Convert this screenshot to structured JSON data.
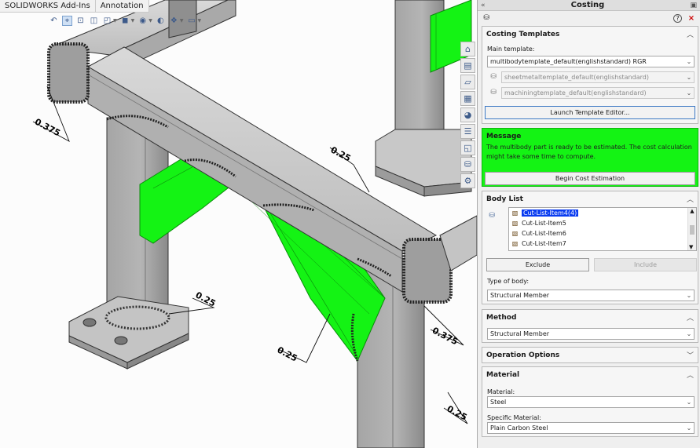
{
  "toolbar": {
    "tabs": [
      "SOLIDWORKS Add-Ins",
      "Annotation"
    ]
  },
  "viewport": {
    "dimensions": [
      "0.375",
      "0.25",
      "0.25",
      "0.25",
      "0.375",
      "0.25"
    ],
    "highlight_color": "#14f314",
    "steel_color": "#b9b9b9"
  },
  "panel": {
    "title": "Costing",
    "collapse_glyph": "«",
    "help_glyph": "?",
    "close_glyph": "×",
    "templates": {
      "title": "Costing Templates",
      "main_label": "Main template:",
      "main_value": "multibodytemplate_default(englishstandard) RGR",
      "sheetmetal_value": "sheetmetaltemplate_default(englishstandard)",
      "machining_value": "machiningtemplate_default(englishstandard)",
      "launch_button": "Launch Template Editor..."
    },
    "message": {
      "title": "Message",
      "text": "The multibody part is ready to be estimated. The cost calculation might take some time to compute.",
      "begin_button": "Begin Cost Estimation"
    },
    "body_list": {
      "title": "Body List",
      "items": [
        "Cut-List-Item4(4)",
        "Cut-List-Item5",
        "Cut-List-Item6",
        "Cut-List-Item7"
      ],
      "selected_index": 0,
      "exclude_button": "Exclude",
      "include_button": "Include",
      "type_label": "Type of body:",
      "type_value": "Structural Member"
    },
    "method": {
      "title": "Method",
      "value": "Structural Member"
    },
    "operation_options": {
      "title": "Operation Options"
    },
    "material": {
      "title": "Material",
      "material_label": "Material:",
      "material_value": "Steel",
      "specific_label": "Specific Material:",
      "specific_value": "Plain Carbon Steel"
    }
  }
}
